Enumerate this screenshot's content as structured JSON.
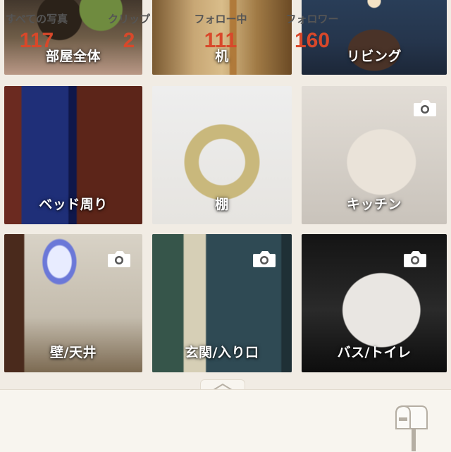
{
  "rooms": [
    {
      "label": "部屋全体",
      "has_camera": false
    },
    {
      "label": "机",
      "has_camera": false
    },
    {
      "label": "リビング",
      "has_camera": false
    },
    {
      "label": "ベッド周り",
      "has_camera": false
    },
    {
      "label": "棚",
      "has_camera": false
    },
    {
      "label": "キッチン",
      "has_camera": true
    },
    {
      "label": "壁/天井",
      "has_camera": true
    },
    {
      "label": "玄関/入り口",
      "has_camera": true
    },
    {
      "label": "バス/トイレ",
      "has_camera": true
    }
  ],
  "stats": [
    {
      "label": "すべての写真",
      "value": "117"
    },
    {
      "label": "クリップ",
      "value": "2"
    },
    {
      "label": "フォロー中",
      "value": "111"
    },
    {
      "label": "フォロワー",
      "value": "160"
    }
  ],
  "icons": {
    "camera": "camera-icon",
    "mailbox": "mailbox-icon",
    "handle": "chevron-up-icon"
  },
  "colors": {
    "stat_value": "#d8482a",
    "background": "#f1ece4"
  }
}
